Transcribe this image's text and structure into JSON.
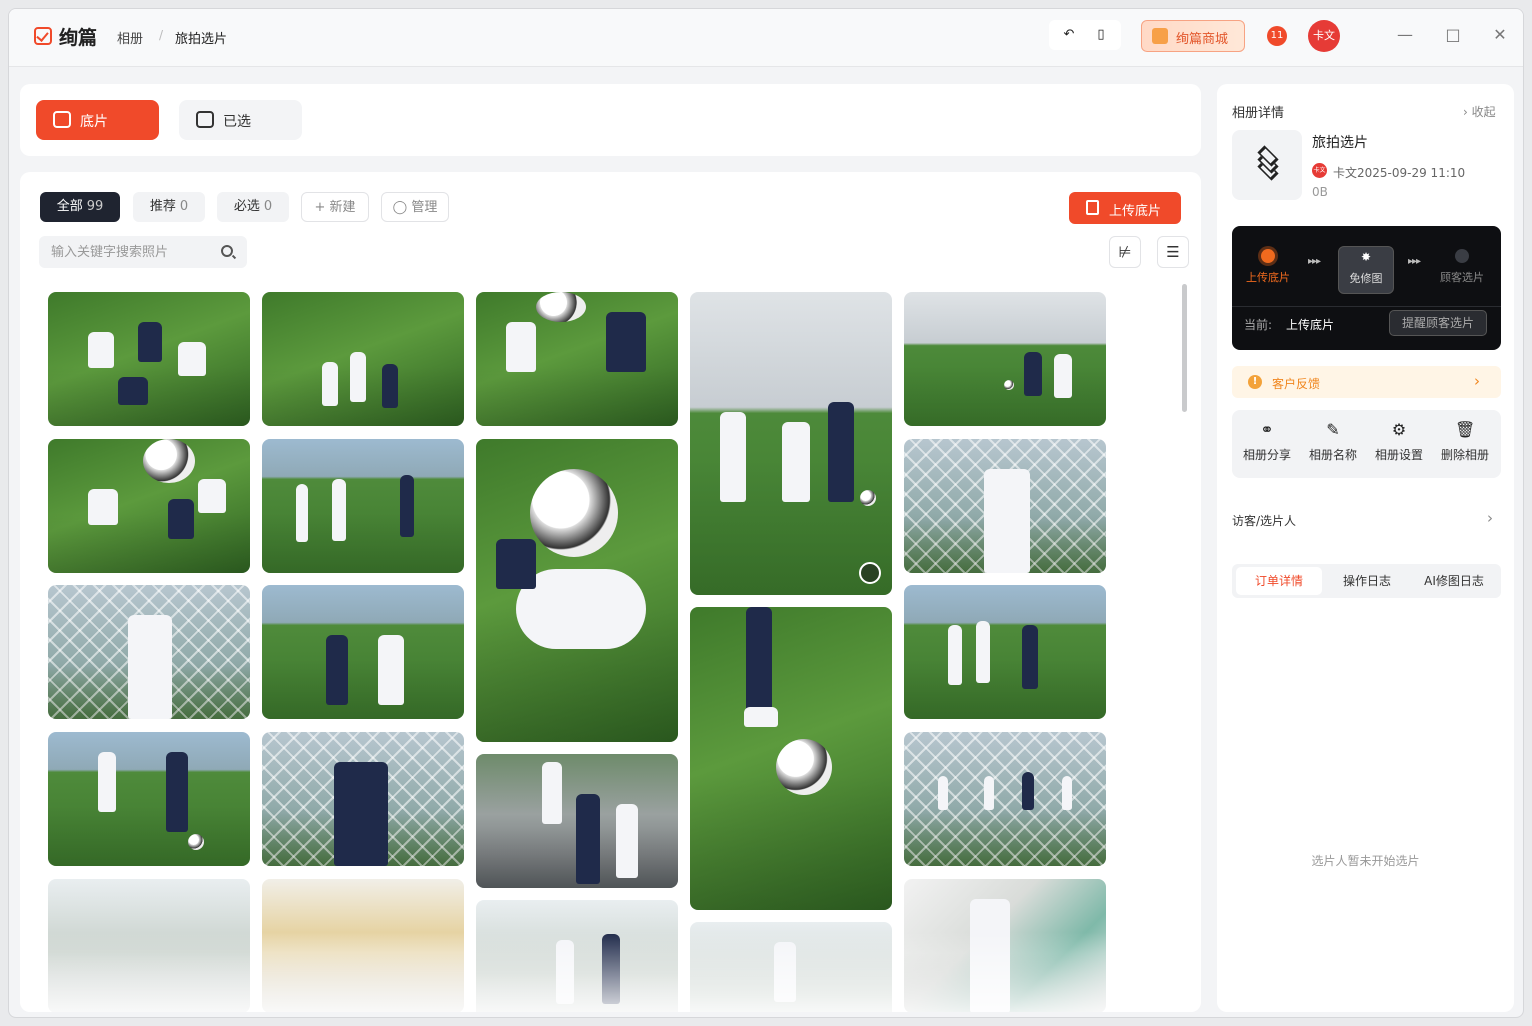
{
  "titlebar": {
    "app_name": "绚篇",
    "breadcrumb": [
      "相册",
      "旅拍选片"
    ],
    "mall_label": "绚篇商城",
    "badge_text": "11",
    "avatar_text": "卡文"
  },
  "top_tabs": [
    {
      "label": "底片",
      "active": true
    },
    {
      "label": "已选",
      "active": false
    }
  ],
  "filters": [
    {
      "label": "全部",
      "count": "99",
      "active": true
    },
    {
      "label": "推荐",
      "count": "0",
      "active": false
    },
    {
      "label": "必选",
      "count": "0",
      "active": false
    }
  ],
  "actions_bar": {
    "new_label": "新建",
    "manage_label": "管理",
    "upload_label": "上传底片"
  },
  "search": {
    "placeholder": "输入关键字搜索照片",
    "value": ""
  },
  "panel": {
    "title": "相册详情",
    "collapse": "收起",
    "album_name": "旅拍选片",
    "owner_avatar": "卡文",
    "owner_time": "卡文2025-09-29 11:10",
    "size": "0B",
    "steps": [
      "上传底片",
      "免修图",
      "顾客选片"
    ],
    "current_label": "当前:",
    "current_value": "上传底片",
    "remind_label": "提醒顾客选片",
    "feedback_label": "客户反馈",
    "album_actions": [
      {
        "label": "相册分享",
        "icon": "share-icon"
      },
      {
        "label": "相册名称",
        "icon": "edit-icon"
      },
      {
        "label": "相册设置",
        "icon": "gear-icon"
      },
      {
        "label": "删除相册",
        "icon": "trash-icon"
      }
    ],
    "visitors_label": "访客/选片人",
    "detail_tabs": [
      {
        "label": "订单详情",
        "active": true
      },
      {
        "label": "操作日志",
        "active": false
      },
      {
        "label": "AI修图日志",
        "active": false
      }
    ],
    "empty_text": "选片人暂未开始选片"
  },
  "colors": {
    "accent": "#f04a2a",
    "dark": "#1f2430",
    "feedback": "#f0861e"
  }
}
